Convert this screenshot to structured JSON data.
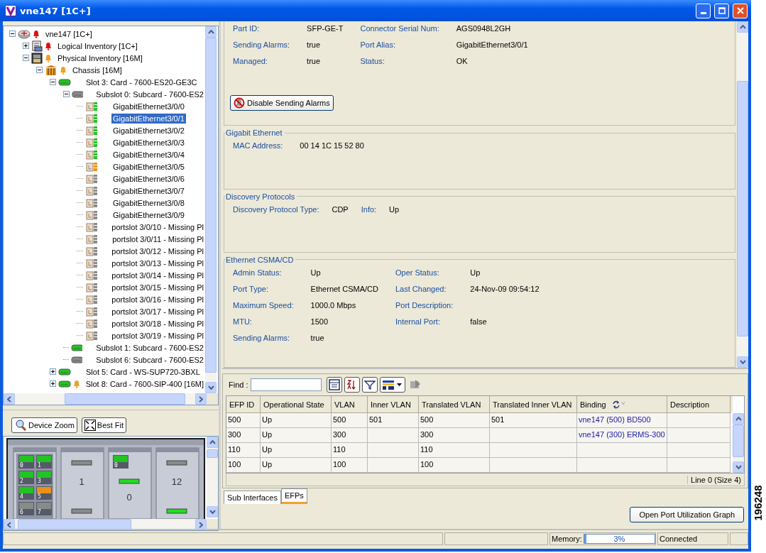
{
  "window": {
    "title": "vne147 [1C+]"
  },
  "tree": [
    {
      "label": "vne147 [1C+]",
      "kind": "device",
      "alarm": {
        "color": "#e01010"
      },
      "expanded": true,
      "selected": false,
      "children": [
        {
          "label": "Logical Inventory [1C+]",
          "kind": "logical",
          "alarm": {
            "color": "#e01010"
          },
          "expanded": false,
          "selected": false
        },
        {
          "label": "Physical Inventory [16M]",
          "kind": "physical",
          "alarm": {
            "color": "#f0a020"
          },
          "expanded": true,
          "selected": false,
          "children": [
            {
              "label": "Chassis [16M]",
              "kind": "chassis",
              "alarm": {
                "color": "#f0a020"
              },
              "expanded": true,
              "selected": false,
              "children": [
                {
                  "label": "Slot 3: Card - 7600-ES20-GE3C",
                  "kind": "card",
                  "color": "#22c322",
                  "expanded": true,
                  "selected": false,
                  "children": [
                    {
                      "label": "Subslot 0: Subcard - 7600-ES2",
                      "kind": "card",
                      "color": "#8a8a8a",
                      "expanded": true,
                      "selected": false,
                      "children": [
                        {
                          "label": "GigabitEthernet3/0/0",
                          "kind": "port",
                          "color": "#22c322",
                          "selected": false
                        },
                        {
                          "label": "GigabitEthernet3/0/1",
                          "kind": "port",
                          "color": "#22c322",
                          "selected": true
                        },
                        {
                          "label": "GigabitEthernet3/0/2",
                          "kind": "port",
                          "color": "#22c322",
                          "selected": false
                        },
                        {
                          "label": "GigabitEthernet3/0/3",
                          "kind": "port",
                          "color": "#22c322",
                          "selected": false
                        },
                        {
                          "label": "GigabitEthernet3/0/4",
                          "kind": "port",
                          "color": "#22c322",
                          "selected": false
                        },
                        {
                          "label": "GigabitEthernet3/0/5",
                          "kind": "port",
                          "color": "#e8921a",
                          "selected": false
                        },
                        {
                          "label": "GigabitEthernet3/0/6",
                          "kind": "port",
                          "color": "#8a8a8a",
                          "selected": false
                        },
                        {
                          "label": "GigabitEthernet3/0/7",
                          "kind": "port",
                          "color": "#8a8a8a",
                          "selected": false
                        },
                        {
                          "label": "GigabitEthernet3/0/8",
                          "kind": "port",
                          "color": "#8a8a8a",
                          "selected": false
                        },
                        {
                          "label": "GigabitEthernet3/0/9",
                          "kind": "port",
                          "color": "#8a8a8a",
                          "selected": false
                        },
                        {
                          "label": "portslot 3/0/10 - Missing Pl",
                          "kind": "port",
                          "color": "#8a8a8a",
                          "selected": false
                        },
                        {
                          "label": "portslot 3/0/11 - Missing Pl",
                          "kind": "port",
                          "color": "#8a8a8a",
                          "selected": false
                        },
                        {
                          "label": "portslot 3/0/12 - Missing Pl",
                          "kind": "port",
                          "color": "#8a8a8a",
                          "selected": false
                        },
                        {
                          "label": "portslot 3/0/13 - Missing Pl",
                          "kind": "port",
                          "color": "#8a8a8a",
                          "selected": false
                        },
                        {
                          "label": "portslot 3/0/14 - Missing Pl",
                          "kind": "port",
                          "color": "#8a8a8a",
                          "selected": false
                        },
                        {
                          "label": "portslot 3/0/15 - Missing Pl",
                          "kind": "port",
                          "color": "#8a8a8a",
                          "selected": false
                        },
                        {
                          "label": "portslot 3/0/16 - Missing Pl",
                          "kind": "port",
                          "color": "#8a8a8a",
                          "selected": false
                        },
                        {
                          "label": "portslot 3/0/17 - Missing Pl",
                          "kind": "port",
                          "color": "#8a8a8a",
                          "selected": false
                        },
                        {
                          "label": "portslot 3/0/18 - Missing Pl",
                          "kind": "port",
                          "color": "#8a8a8a",
                          "selected": false
                        },
                        {
                          "label": "portslot 3/0/19 - Missing Pl",
                          "kind": "port",
                          "color": "#8a8a8a",
                          "selected": false
                        }
                      ]
                    },
                    {
                      "label": "Subslot 1: Subcard - 7600-ES2",
                      "kind": "card",
                      "color": "#22c322",
                      "selected": false
                    },
                    {
                      "label": "Subslot 6: Subcard - 7600-ES2",
                      "kind": "card",
                      "color": "#8a8a8a",
                      "selected": false
                    }
                  ]
                },
                {
                  "label": "Slot 5: Card - WS-SUP720-3BXL",
                  "kind": "card",
                  "color": "#22c322",
                  "expanded": false,
                  "selected": false
                },
                {
                  "label": "Slot 8: Card - 7600-SIP-400 [16M]",
                  "kind": "card",
                  "color": "#22c322",
                  "alarm": {
                    "color": "#f0a020"
                  },
                  "expanded": false,
                  "selected": false
                }
              ]
            }
          ]
        }
      ]
    }
  ],
  "view_toolbar": [
    "Device Zoom",
    "Best Fit"
  ],
  "rack": {
    "ports": [
      {
        "label": "0",
        "color": "#22c322"
      },
      {
        "label": "1",
        "color": "#22c322"
      },
      {
        "label": "2",
        "color": "#22c322"
      },
      {
        "label": "3",
        "color": "#22c322"
      },
      {
        "label": "4",
        "color": "#22c322"
      },
      {
        "label": "5",
        "color": "#e8921a"
      },
      {
        "label": "6",
        "color": "#8a8a8a"
      },
      {
        "label": "7",
        "color": "#8a8a8a"
      }
    ],
    "modules": [
      {
        "label": "1",
        "leds": [
          {
            "on": false
          },
          {
            "on": false
          }
        ]
      },
      {
        "label": "0",
        "leds": [
          {
            "on": true
          }
        ],
        "ports": [
          {
            "label": "0",
            "color": "#22c322"
          }
        ]
      },
      {
        "label": "12",
        "leds": [
          {
            "on": false
          },
          {
            "on": true
          }
        ]
      }
    ]
  },
  "properties": [
    {
      "kind": "grid",
      "rows": [
        [
          {
            "label": "Part ID:",
            "value": "SFP-GE-T"
          },
          {
            "label": "Connector Serial Num:",
            "value": "AGS0948L2GH"
          }
        ],
        [
          {
            "label": "Sending Alarms:",
            "value": "true"
          },
          {
            "label": "Port Alias:",
            "value": "GigabitEthernet3/0/1"
          }
        ],
        [
          {
            "label": "Managed:",
            "value": "true"
          },
          {
            "label": "Status:",
            "value": "OK"
          }
        ]
      ],
      "button": "Disable Sending Alarms"
    },
    {
      "kind": "grid",
      "title": "Gigabit Ethernet",
      "rows": [
        [
          {
            "label": "MAC Address:",
            "value": "00 14 1C 15 52 80"
          }
        ]
      ]
    },
    {
      "kind": "inline",
      "title": "Discovery Protocols",
      "rows": [
        [
          {
            "label": "Discovery Protocol Type:",
            "value": "CDP"
          },
          {
            "label": "Info:",
            "value": "Up"
          }
        ]
      ]
    },
    {
      "kind": "grid",
      "title": "Ethernet CSMA/CD",
      "rows": [
        [
          {
            "label": "Admin Status:",
            "value": "Up"
          },
          {
            "label": "Oper Status:",
            "value": "Up"
          }
        ],
        [
          {
            "label": "Port Type:",
            "value": "Ethernet CSMA/CD"
          },
          {
            "label": "Last Changed:",
            "value": "24-Nov-09 09:54:12"
          }
        ],
        [
          {
            "label": "Maximum Speed:",
            "value": "1000.0 Mbps"
          },
          {
            "label": "Port Description:"
          }
        ],
        [
          {
            "label": "MTU:",
            "value": "1500"
          },
          {
            "label": "Internal Port:",
            "value": "false"
          }
        ],
        [
          {
            "label": "Sending Alarms:",
            "value": "true"
          }
        ]
      ]
    }
  ],
  "find": {
    "label": "Find :"
  },
  "table": {
    "columns": [
      {
        "label": "EFP ID"
      },
      {
        "label": "Operational State"
      },
      {
        "label": "VLAN"
      },
      {
        "label": "Inner VLAN"
      },
      {
        "label": "Translated VLAN"
      },
      {
        "label": "Translated Inner VLAN"
      },
      {
        "label": "Binding",
        "kind": "link"
      },
      {
        "label": "Description"
      }
    ],
    "rows": [
      {
        "efp_id": "500",
        "operational_state": "Up",
        "vlan": "500",
        "inner_vlan": "501",
        "translated_vlan": "500",
        "translated_inner_vlan": "501",
        "binding": "vne147 (500) BD500"
      },
      {
        "efp_id": "300",
        "operational_state": "Up",
        "vlan": "300",
        "translated_vlan": "300",
        "binding": "vne147 (300) ERMS-300"
      },
      {
        "efp_id": "110",
        "operational_state": "Up",
        "vlan": "110",
        "translated_vlan": "110"
      },
      {
        "efp_id": "100",
        "operational_state": "Up",
        "vlan": "100",
        "translated_vlan": "100"
      }
    ],
    "footer": "Line 0 (Size 4)"
  },
  "tabs": [
    {
      "label": "Sub Interfaces",
      "selected": false
    },
    {
      "label": "EFPs",
      "selected": true
    }
  ],
  "graph_button": "Open Port Utilization Graph",
  "status_bar": {
    "memory": {
      "label": "Memory:",
      "reading": "3%",
      "level": 0.03
    },
    "connection": "Connected"
  },
  "figure_number": "196248"
}
